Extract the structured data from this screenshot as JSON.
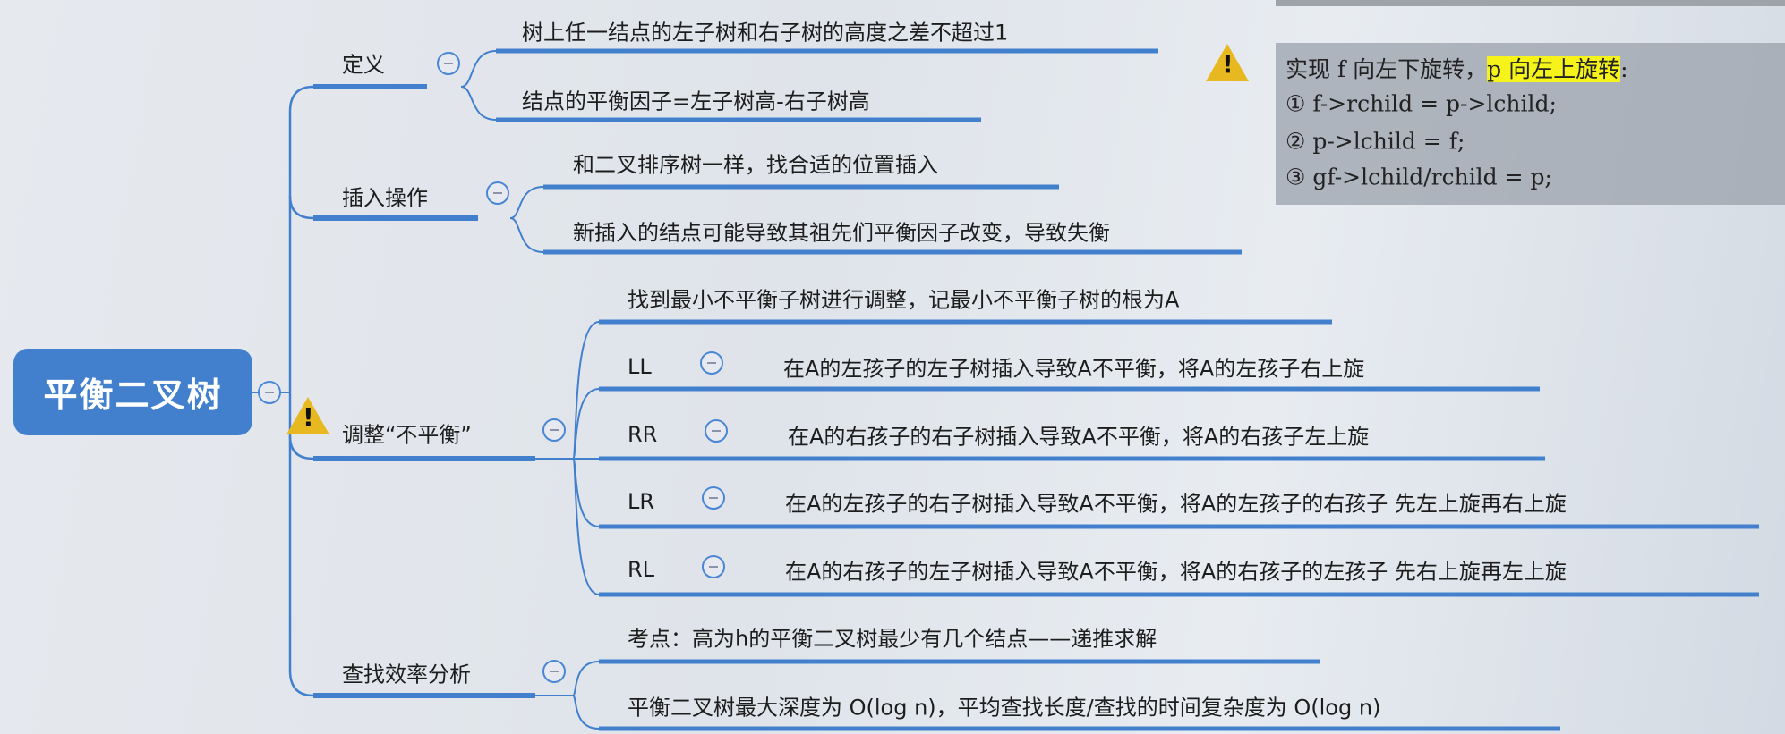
{
  "root": {
    "label": "平衡二叉树"
  },
  "branches": [
    {
      "label": "定义",
      "children": [
        "树上任一结点的左子树和右子树的高度之差不超过1",
        "结点的平衡因子=左子树高-右子树高"
      ]
    },
    {
      "label": "插入操作",
      "children": [
        "和二叉排序树一样，找合适的位置插入",
        "新插入的结点可能导致其祖先们平衡因子改变，导致失衡"
      ]
    },
    {
      "label": "调整“不平衡”",
      "children": [
        {
          "tag": "",
          "text": "找到最小不平衡子树进行调整，记最小不平衡子树的根为A"
        },
        {
          "tag": "LL",
          "text": "在A的左孩子的左子树插入导致A不平衡，将A的左孩子右上旋"
        },
        {
          "tag": "RR",
          "text": "在A的右孩子的右子树插入导致A不平衡，将A的右孩子左上旋"
        },
        {
          "tag": "LR",
          "text": "在A的左孩子的右子树插入导致A不平衡，将A的左孩子的右孩子 先左上旋再右上旋"
        },
        {
          "tag": "RL",
          "text": "在A的右孩子的左子树插入导致A不平衡，将A的右孩子的左孩子 先右上旋再左上旋"
        }
      ]
    },
    {
      "label": "查找效率分析",
      "children": [
        "考点：高为h的平衡二叉树最少有几个结点——递推求解",
        "平衡二叉树最大深度为 O(log n)，平均查找长度/查找的时间复杂度为 O(log n)"
      ]
    }
  ],
  "note": {
    "line1_a": "实现 f 向左下旋转，",
    "line1_b": "p 向左上旋转",
    "line1_c": ":",
    "steps": [
      "① f->rchild = p->lchild;",
      "② p->lchild = f;",
      "③ gf->lchild/rchild = p;"
    ]
  },
  "colors": {
    "accent": "#4280cd",
    "highlight": "#f5f31a",
    "warning": "#e8b820"
  }
}
